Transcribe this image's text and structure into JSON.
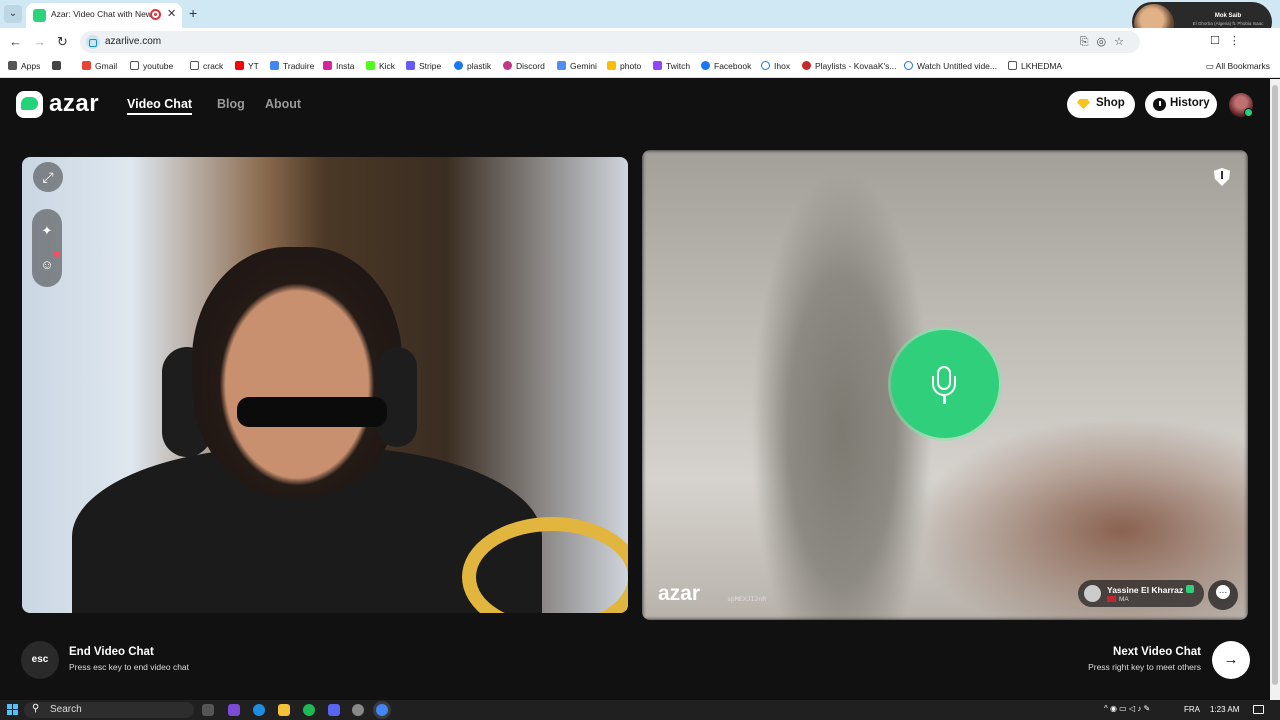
{
  "browser": {
    "tab_title": "Azar: Video Chat with New",
    "tab_close": "✕",
    "new_tab": "+",
    "url": "azarlive.com",
    "profile_card": {
      "name": "Mok Saib",
      "subtitle": "El Ghorba (Algeria) ft. Phobia Isaac #ZazRadio"
    },
    "bookmarks": [
      "Apps",
      "Gmail",
      "youtube",
      "crack",
      "YT",
      "Traduire",
      "Insta",
      "Kick",
      "Stripe",
      "plastik",
      "Discord",
      "Gemini",
      "photo",
      "Twitch",
      "Facebook",
      "Ihox",
      "Playlists - KovaaK's...",
      "Watch Untitled vide...",
      "LKHEDMA"
    ],
    "all_bookmarks": "All Bookmarks"
  },
  "site": {
    "logo": "azar",
    "nav": {
      "video_chat": "Video Chat",
      "blog": "Blog",
      "about": "About"
    },
    "shop_label": "Shop",
    "history_label": "History"
  },
  "remote": {
    "watermark_logo": "azar",
    "watermark_code": "spMEXJIJnR",
    "peer_name": "Yassine El Kharraz",
    "peer_country": "MA"
  },
  "controls": {
    "esc_key": "esc",
    "end_title": "End Video Chat",
    "end_hint": "Press esc key to end video chat",
    "next_title": "Next Video Chat",
    "next_hint": "Press right key to meet others",
    "next_arrow": "→"
  },
  "taskbar": {
    "search": "Search",
    "lang": "FRA",
    "time": "1:23 AM"
  },
  "colors": {
    "accent": "#2fcf7c",
    "gold": "#f7c41a"
  }
}
